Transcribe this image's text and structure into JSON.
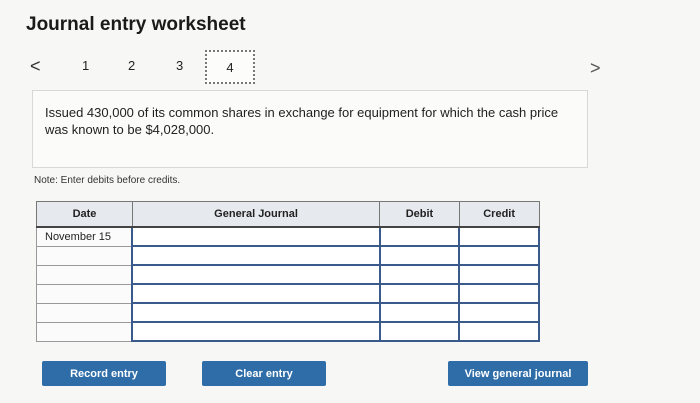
{
  "title": "Journal entry worksheet",
  "nav": {
    "prev_glyph": "<",
    "next_glyph": ">",
    "steps": [
      "1",
      "2",
      "3",
      "4"
    ],
    "active_step": "4"
  },
  "problem_text": "Issued 430,000 of its common shares in exchange for equipment for which the cash price was known to be $4,028,000.",
  "note": "Note: Enter debits before credits.",
  "table": {
    "headers": [
      "Date",
      "General Journal",
      "Debit",
      "Credit"
    ],
    "rows": [
      {
        "date": "November 15"
      },
      {
        "date": ""
      },
      {
        "date": ""
      },
      {
        "date": ""
      },
      {
        "date": ""
      },
      {
        "date": ""
      }
    ]
  },
  "buttons": {
    "record": "Record entry",
    "clear": "Clear entry",
    "view": "View general journal"
  },
  "colors": {
    "button": "#2e6da8",
    "header_bg": "#e6e9ee",
    "input_border": "#3a5a8c"
  }
}
